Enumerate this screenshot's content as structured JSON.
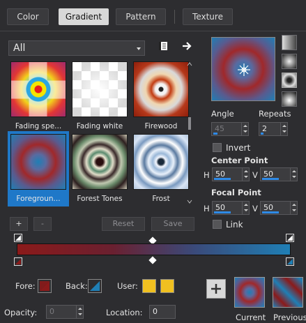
{
  "tabs": [
    {
      "label": "Color",
      "active": false
    },
    {
      "label": "Gradient",
      "active": true
    },
    {
      "label": "Pattern",
      "active": false
    },
    {
      "label": "Texture",
      "active": false
    }
  ],
  "category": {
    "value": "All"
  },
  "gradients": [
    {
      "label": "Fading spe...",
      "selected": false
    },
    {
      "label": "Fading white",
      "selected": false
    },
    {
      "label": "Firewood",
      "selected": false
    },
    {
      "label": "Foregroun...",
      "selected": true
    },
    {
      "label": "Forest Tones",
      "selected": false
    },
    {
      "label": "Frost",
      "selected": false
    }
  ],
  "list_buttons": {
    "add": "+",
    "remove": "-",
    "reset": "Reset",
    "save": "Save"
  },
  "settings": {
    "angle_label": "Angle",
    "angle_value": "45",
    "repeats_label": "Repeats",
    "repeats_value": "2",
    "invert_label": "Invert",
    "center_point_label": "Center Point",
    "focal_point_label": "Focal Point",
    "h_label": "H",
    "v_label": "V",
    "center_h": "50",
    "center_v": "50",
    "focal_h": "50",
    "focal_v": "50",
    "link_label": "Link"
  },
  "bottom": {
    "fore_label": "Fore:",
    "back_label": "Back:",
    "user_label": "User:",
    "opacity_label": "Opacity:",
    "opacity_value": "0",
    "location_label": "Location:",
    "location_value": "0",
    "current_label": "Current",
    "previous_label": "Previous"
  },
  "colors": {
    "accent": "#1f78c8",
    "fore": "#8b1a1a",
    "back": "#1f7fb5",
    "user": "#f0c020"
  },
  "icons": [
    "book-icon",
    "arrow-right-icon",
    "add-icon",
    "reset-crosshair-icon"
  ]
}
